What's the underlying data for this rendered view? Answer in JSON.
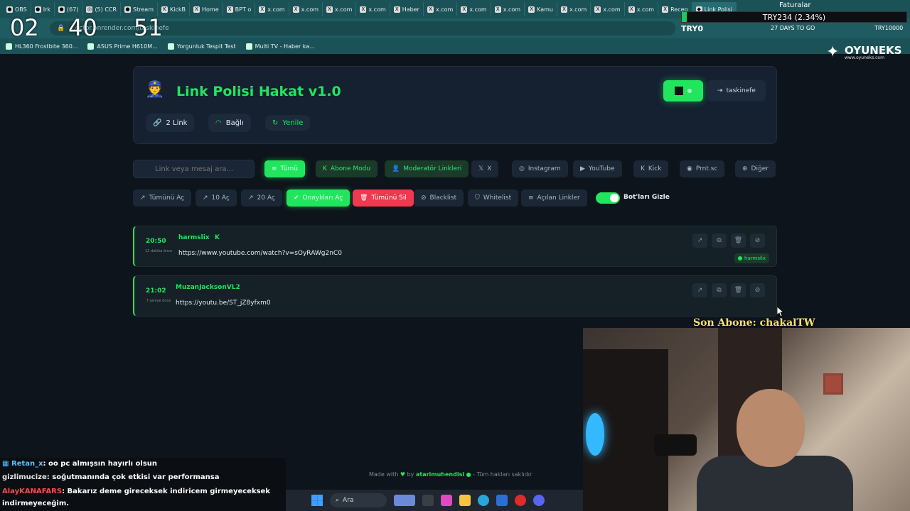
{
  "browser": {
    "tabs": [
      {
        "label": "OBS",
        "icon": "tab-red-icon"
      },
      {
        "label": "Irk",
        "icon": "tab-red-icon"
      },
      {
        "label": "(67)",
        "icon": "tab-red-icon"
      },
      {
        "label": "(5) CCR",
        "icon": "tab-instagram-icon"
      },
      {
        "label": "Stream",
        "icon": "tab-red-icon"
      },
      {
        "label": "KickB",
        "icon": "tab-kick-icon"
      },
      {
        "label": "Home",
        "icon": "tab-x-icon"
      },
      {
        "label": "BPT o",
        "icon": "tab-x-icon"
      },
      {
        "label": "x.com",
        "icon": "tab-x-icon"
      },
      {
        "label": "x.com",
        "icon": "tab-x-icon"
      },
      {
        "label": "x.com",
        "icon": "tab-x-icon"
      },
      {
        "label": "x.com",
        "icon": "tab-x-icon"
      },
      {
        "label": "Haber",
        "icon": "tab-x-icon"
      },
      {
        "label": "x.com",
        "icon": "tab-x-icon"
      },
      {
        "label": "x.com",
        "icon": "tab-x-icon"
      },
      {
        "label": "x.com",
        "icon": "tab-x-icon"
      },
      {
        "label": "Kamu",
        "icon": "tab-x-icon"
      },
      {
        "label": "x.com",
        "icon": "tab-x-icon"
      },
      {
        "label": "x.com",
        "icon": "tab-x-icon"
      },
      {
        "label": "x.com",
        "icon": "tab-x-icon"
      },
      {
        "label": "Recep",
        "icon": "tab-x-icon"
      },
      {
        "label": "Link Polisi",
        "icon": "tab-app-icon",
        "active": true
      }
    ],
    "url": "...ector.onrender.com/taskinefe",
    "bookmarks": [
      "HL360 Frostbite 360...",
      "ASUS Prime H610M...",
      "Yorgunluk Tespit Test",
      "Multi TV - Haber ka..."
    ]
  },
  "overlay": {
    "timer": {
      "h": "02",
      "m": "40",
      "s": "51"
    },
    "faturalar": "Faturalar",
    "ticker": "TRY234 (2.34%)",
    "ticker_progress": 0.0234,
    "try0": "TRY0",
    "days": "27 DAYS TO GO",
    "try10000": "TRY10000",
    "logo_title": "OYUNEKS",
    "logo_sub": "www.oyuneks.com",
    "son_abone": "Son Abone: chakalTW"
  },
  "app": {
    "title": "Link Polisi Hakat v1.0",
    "pills": {
      "links": "2 Link",
      "status": "Bağlı",
      "refresh": "Yenile"
    },
    "user_button": "taskinefe",
    "search_placeholder": "Link veya mesaj ara...",
    "filters": [
      {
        "label": "Tümü",
        "icon": "list-icon",
        "style": "sel"
      },
      {
        "label": "Abone Modu",
        "icon": "kick-icon",
        "style": "greenish"
      },
      {
        "label": "Moderatör Linkleri",
        "icon": "user-shield-icon",
        "style": "greenish"
      },
      {
        "label": "X",
        "icon": "x-icon",
        "style": ""
      },
      {
        "label": "Instagram",
        "icon": "instagram-icon",
        "style": ""
      },
      {
        "label": "YouTube",
        "icon": "youtube-icon",
        "style": ""
      },
      {
        "label": "Kick",
        "icon": "kick-icon",
        "style": ""
      },
      {
        "label": "Prnt.sc",
        "icon": "camera-icon",
        "style": ""
      },
      {
        "label": "Diğer",
        "icon": "globe-icon",
        "style": ""
      }
    ],
    "actions": [
      {
        "label": "Tümünü Aç",
        "icon": "external-link-icon",
        "style": ""
      },
      {
        "label": "10 Aç",
        "icon": "external-link-icon",
        "style": ""
      },
      {
        "label": "20 Aç",
        "icon": "external-link-icon",
        "style": ""
      },
      {
        "label": "Onaylıları Aç",
        "icon": "check-circle-icon",
        "style": "sel"
      },
      {
        "label": "Tümünü Sil",
        "icon": "trash-icon",
        "style": "red"
      },
      {
        "label": "Blacklist",
        "icon": "ban-icon",
        "style": ""
      },
      {
        "label": "Whitelist",
        "icon": "shield-icon",
        "style": ""
      },
      {
        "label": "Açılan Linkler",
        "icon": "list-icon",
        "style": ""
      }
    ],
    "bot_toggle_label": "Bot'ları Gizle",
    "bot_toggle_on": true,
    "links": [
      {
        "time": "20:50",
        "ago": "12 dakika önce",
        "user": "harmslix",
        "url": "https://www.youtube.com/watch?v=sOyRAWg2nC0",
        "approved_by": "harmslix"
      },
      {
        "time": "21:02",
        "ago": "7 saniye önce",
        "user": "MuzanJacksonVL2",
        "url": "https://youtu.be/ST_jZ8yfxm0",
        "approved_by": ""
      }
    ],
    "footer": {
      "made_with": "Made with",
      "by": "by",
      "author": "atarimuhendisi",
      "rights": "- Tüm hakları saklıdır"
    }
  },
  "chat": [
    {
      "user": "Retan_x",
      "msg": ": oo pc almışsın hayırlı olsun",
      "style": "u"
    },
    {
      "user": "gizlimucize",
      "msg": ": soğutmanında çok etkisi var performansa",
      "style": "u2"
    },
    {
      "user": "AlayKANAFARS",
      "msg": ": Bakarız deme gireceksek indiricem girmeyeceksek",
      "style": "u3"
    },
    {
      "user": "",
      "msg": "indirmeyeceğim.",
      "style": "u2"
    }
  ],
  "taskbar": {
    "search": "Ara"
  }
}
